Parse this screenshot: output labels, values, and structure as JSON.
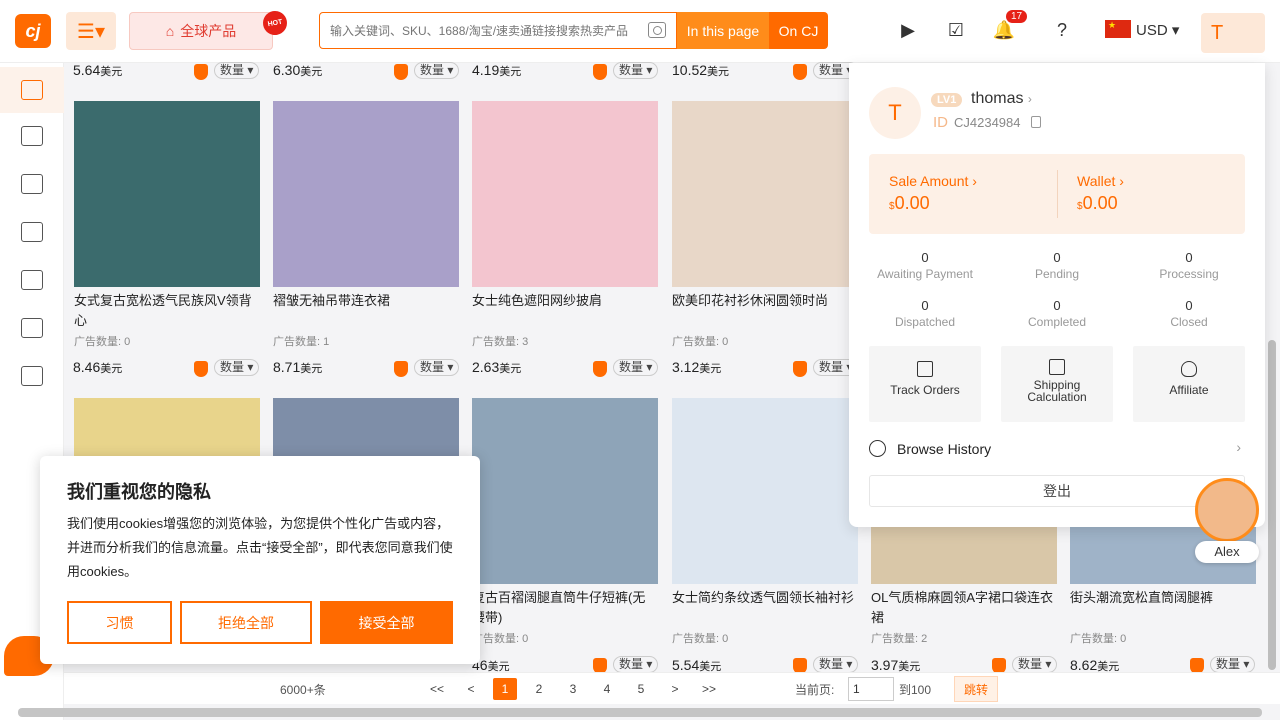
{
  "header": {
    "logo_text": "cj",
    "global_products_label": "全球产品",
    "hot_badge": "HOT",
    "search_placeholder": "输入关键词、SKU、1688/淘宝/速卖通链接搜索热卖产品",
    "in_page_label": "In this page",
    "on_cj_label": "On CJ",
    "notification_count": "17",
    "currency": "USD",
    "avatar_letter": "T"
  },
  "top_row_prices": [
    {
      "price": "5.64",
      "unit": "美元",
      "qty": "数量"
    },
    {
      "price": "6.30",
      "unit": "美元",
      "qty": "数量"
    },
    {
      "price": "4.19",
      "unit": "美元",
      "qty": "数量"
    },
    {
      "price": "10.52",
      "unit": "美元",
      "qty": "数量"
    }
  ],
  "products_row1": [
    {
      "name": "女式复古宽松透气民族风V领背心",
      "ads": "广告数量: 0",
      "price": "8.46",
      "unit": "美元",
      "qty": "数量",
      "img_color": "#3b6b6d"
    },
    {
      "name": "褶皱无袖吊带连衣裙",
      "ads": "广告数量: 1",
      "price": "8.71",
      "unit": "美元",
      "qty": "数量",
      "img_color": "#a9a0c9"
    },
    {
      "name": "女士纯色遮阳网纱披肩",
      "ads": "广告数量: 3",
      "price": "2.63",
      "unit": "美元",
      "qty": "数量",
      "img_color": "#f3c5cf"
    },
    {
      "name": "欧美印花衬衫休闲圆领时尚",
      "ads": "广告数量: 0",
      "price": "3.12",
      "unit": "美元",
      "qty": "数量",
      "img_color": "#e8d7c8"
    }
  ],
  "products_row2": [
    {
      "name": "",
      "ads": "",
      "price": "",
      "unit": "",
      "qty": "",
      "img_color": "#e8d48b"
    },
    {
      "name": "",
      "ads": "",
      "price": "",
      "unit": "",
      "qty": "",
      "img_color": "#7e8ea8"
    },
    {
      "name": "复古百褶阔腿直筒牛仔短裤(无腰带)",
      "ads": "广告数量: 0",
      "price": "46",
      "unit": "美元",
      "qty": "数量",
      "img_color": "#8ea4b8"
    },
    {
      "name": "女士简约条纹透气圆领长袖衬衫",
      "ads": "广告数量: 0",
      "price": "5.54",
      "unit": "美元",
      "qty": "数量",
      "img_color": "#dde6f0"
    },
    {
      "name": "OL气质棉麻圆领A字裙口袋连衣裙",
      "ads": "广告数量: 2",
      "price": "3.97",
      "unit": "美元",
      "qty": "数量",
      "img_color": "#d9c7a8"
    },
    {
      "name": "街头潮流宽松直筒阔腿裤",
      "ads": "广告数量: 0",
      "price": "8.62",
      "unit": "美元",
      "qty": "数量",
      "img_color": "#9fb3c8"
    }
  ],
  "pagination": {
    "total": "6000+条",
    "first": "<<",
    "prev": "<",
    "pages": [
      "1",
      "2",
      "3",
      "4",
      "5"
    ],
    "next": ">",
    "last": ">>",
    "current_label": "当前页:",
    "current_value": "1",
    "to_label": "到100",
    "goto_label": "跳转"
  },
  "privacy": {
    "title": "我们重视您的隐私",
    "body": "我们使用cookies增强您的浏览体验，为您提供个性化广告或内容，并进而分析我们的信息流量。点击“接受全部”，即代表您同意我们使用cookies。",
    "btn_custom": "习惯",
    "btn_reject": "拒绝全部",
    "btn_accept": "接受全部"
  },
  "user_panel": {
    "avatar_letter": "T",
    "level": "LV1",
    "username": "thomas",
    "id_label": "ID",
    "id_value": "CJ4234984",
    "sale_label": "Sale Amount",
    "sale_currency": "$",
    "sale_value": "0.00",
    "wallet_label": "Wallet",
    "wallet_currency": "$",
    "wallet_value": "0.00",
    "stats": [
      {
        "n": "0",
        "l": "Awaiting Payment"
      },
      {
        "n": "0",
        "l": "Pending"
      },
      {
        "n": "0",
        "l": "Processing"
      },
      {
        "n": "0",
        "l": "Dispatched"
      },
      {
        "n": "0",
        "l": "Completed"
      },
      {
        "n": "0",
        "l": "Closed"
      }
    ],
    "tools": [
      "Track Orders",
      "Shipping Calculation",
      "Affiliate"
    ],
    "browse_history": "Browse History",
    "logout": "登出"
  },
  "assistant": {
    "name": "Alex"
  },
  "colors": {
    "brand": "#ff6a00"
  }
}
